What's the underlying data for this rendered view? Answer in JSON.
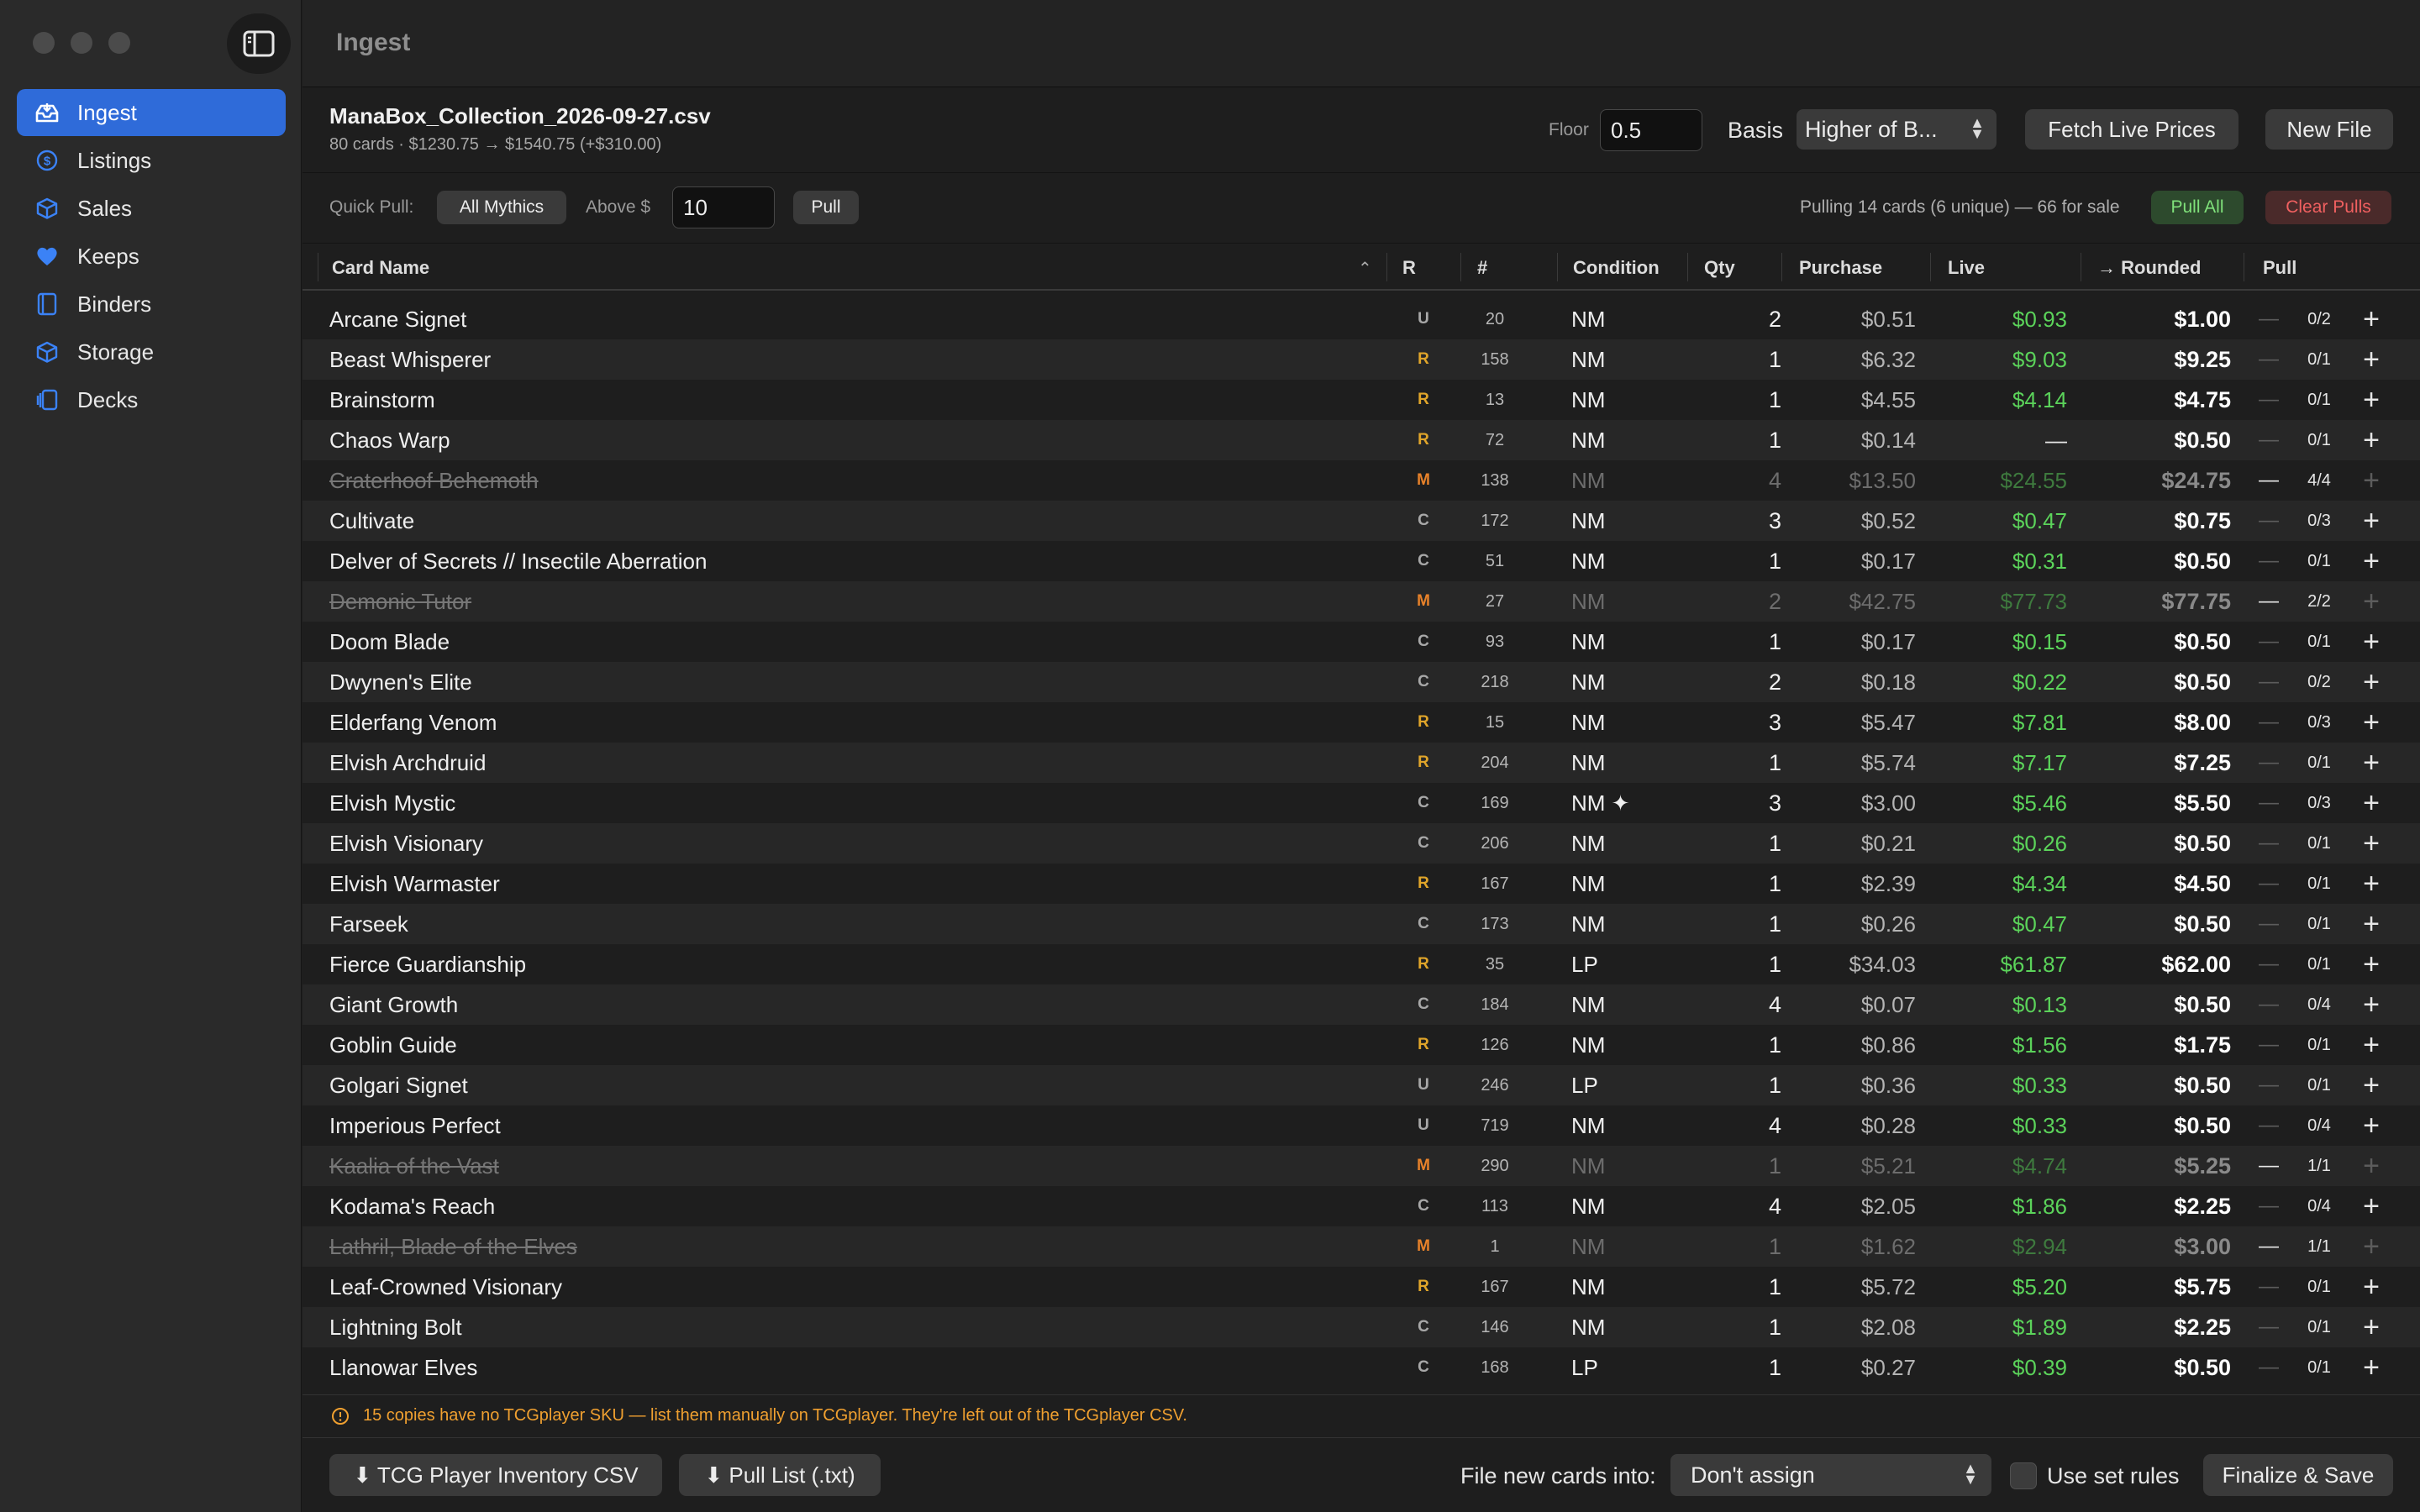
{
  "app": {
    "title": "Ingest"
  },
  "sidebar": {
    "items": [
      {
        "label": "Ingest",
        "icon": "ingest-tray-icon",
        "active": true
      },
      {
        "label": "Listings",
        "icon": "dollar-circle-icon"
      },
      {
        "label": "Sales",
        "icon": "box-icon"
      },
      {
        "label": "Keeps",
        "icon": "heart-icon"
      },
      {
        "label": "Binders",
        "icon": "book-icon"
      },
      {
        "label": "Storage",
        "icon": "cube-icon"
      },
      {
        "label": "Decks",
        "icon": "cards-stack-icon"
      }
    ]
  },
  "file": {
    "name": "ManaBox_Collection_2026-09-27.csv",
    "summary": "80 cards · $1230.75 → $1540.75 (+$310.00)",
    "floor_label": "Floor",
    "floor_value": "0.5",
    "basis_label": "Basis",
    "basis_value": "Higher of B...",
    "fetch_label": "Fetch Live Prices",
    "newfile_label": "New File"
  },
  "quickpull": {
    "label": "Quick Pull:",
    "all_mythics": "All Mythics",
    "above_label": "Above $",
    "above_value": "10",
    "pull_label": "Pull",
    "status": "Pulling 14 cards (6 unique) — 66 for sale",
    "pull_all": "Pull All",
    "clear_pulls": "Clear Pulls"
  },
  "table": {
    "headers": {
      "name": "Card Name",
      "r": "R",
      "num": "#",
      "condition": "Condition",
      "qty": "Qty",
      "purchase": "Purchase",
      "live": "Live",
      "rounded": "→ Rounded",
      "pull": "Pull"
    },
    "rows": [
      {
        "name": "Arcane Signet",
        "r": "U",
        "num": "20",
        "cond": "NM",
        "qty": "2",
        "purchase": "$0.51",
        "live": "$0.93",
        "rounded": "$1.00",
        "pull": "0/2",
        "pulled": false
      },
      {
        "name": "Beast Whisperer",
        "r": "R",
        "num": "158",
        "cond": "NM",
        "qty": "1",
        "purchase": "$6.32",
        "live": "$9.03",
        "rounded": "$9.25",
        "pull": "0/1",
        "pulled": false
      },
      {
        "name": "Brainstorm",
        "r": "R",
        "num": "13",
        "cond": "NM",
        "qty": "1",
        "purchase": "$4.55",
        "live": "$4.14",
        "rounded": "$4.75",
        "pull": "0/1",
        "pulled": false
      },
      {
        "name": "Chaos Warp",
        "r": "R",
        "num": "72",
        "cond": "NM",
        "qty": "1",
        "purchase": "$0.14",
        "live": "—",
        "rounded": "$0.50",
        "pull": "0/1",
        "pulled": false
      },
      {
        "name": "Craterhoof Behemoth",
        "r": "M",
        "num": "138",
        "cond": "NM",
        "qty": "4",
        "purchase": "$13.50",
        "live": "$24.55",
        "rounded": "$24.75",
        "pull": "4/4",
        "pulled": true
      },
      {
        "name": "Cultivate",
        "r": "C",
        "num": "172",
        "cond": "NM",
        "qty": "3",
        "purchase": "$0.52",
        "live": "$0.47",
        "rounded": "$0.75",
        "pull": "0/3",
        "pulled": false
      },
      {
        "name": "Delver of Secrets // Insectile Aberration",
        "r": "C",
        "num": "51",
        "cond": "NM",
        "qty": "1",
        "purchase": "$0.17",
        "live": "$0.31",
        "rounded": "$0.50",
        "pull": "0/1",
        "pulled": false
      },
      {
        "name": "Demonic Tutor",
        "r": "M",
        "num": "27",
        "cond": "NM",
        "qty": "2",
        "purchase": "$42.75",
        "live": "$77.73",
        "rounded": "$77.75",
        "pull": "2/2",
        "pulled": true
      },
      {
        "name": "Doom Blade",
        "r": "C",
        "num": "93",
        "cond": "NM",
        "qty": "1",
        "purchase": "$0.17",
        "live": "$0.15",
        "rounded": "$0.50",
        "pull": "0/1",
        "pulled": false
      },
      {
        "name": "Dwynen's Elite",
        "r": "C",
        "num": "218",
        "cond": "NM",
        "qty": "2",
        "purchase": "$0.18",
        "live": "$0.22",
        "rounded": "$0.50",
        "pull": "0/2",
        "pulled": false
      },
      {
        "name": "Elderfang Venom",
        "r": "R",
        "num": "15",
        "cond": "NM",
        "qty": "3",
        "purchase": "$5.47",
        "live": "$7.81",
        "rounded": "$8.00",
        "pull": "0/3",
        "pulled": false
      },
      {
        "name": "Elvish Archdruid",
        "r": "R",
        "num": "204",
        "cond": "NM",
        "qty": "1",
        "purchase": "$5.74",
        "live": "$7.17",
        "rounded": "$7.25",
        "pull": "0/1",
        "pulled": false
      },
      {
        "name": "Elvish Mystic",
        "r": "C",
        "num": "169",
        "cond": "NM ✦",
        "qty": "3",
        "purchase": "$3.00",
        "live": "$5.46",
        "rounded": "$5.50",
        "pull": "0/3",
        "pulled": false
      },
      {
        "name": "Elvish Visionary",
        "r": "C",
        "num": "206",
        "cond": "NM",
        "qty": "1",
        "purchase": "$0.21",
        "live": "$0.26",
        "rounded": "$0.50",
        "pull": "0/1",
        "pulled": false
      },
      {
        "name": "Elvish Warmaster",
        "r": "R",
        "num": "167",
        "cond": "NM",
        "qty": "1",
        "purchase": "$2.39",
        "live": "$4.34",
        "rounded": "$4.50",
        "pull": "0/1",
        "pulled": false
      },
      {
        "name": "Farseek",
        "r": "C",
        "num": "173",
        "cond": "NM",
        "qty": "1",
        "purchase": "$0.26",
        "live": "$0.47",
        "rounded": "$0.50",
        "pull": "0/1",
        "pulled": false
      },
      {
        "name": "Fierce Guardianship",
        "r": "R",
        "num": "35",
        "cond": "LP",
        "qty": "1",
        "purchase": "$34.03",
        "live": "$61.87",
        "rounded": "$62.00",
        "pull": "0/1",
        "pulled": false
      },
      {
        "name": "Giant Growth",
        "r": "C",
        "num": "184",
        "cond": "NM",
        "qty": "4",
        "purchase": "$0.07",
        "live": "$0.13",
        "rounded": "$0.50",
        "pull": "0/4",
        "pulled": false
      },
      {
        "name": "Goblin Guide",
        "r": "R",
        "num": "126",
        "cond": "NM",
        "qty": "1",
        "purchase": "$0.86",
        "live": "$1.56",
        "rounded": "$1.75",
        "pull": "0/1",
        "pulled": false
      },
      {
        "name": "Golgari Signet",
        "r": "U",
        "num": "246",
        "cond": "LP",
        "qty": "1",
        "purchase": "$0.36",
        "live": "$0.33",
        "rounded": "$0.50",
        "pull": "0/1",
        "pulled": false
      },
      {
        "name": "Imperious Perfect",
        "r": "U",
        "num": "719",
        "cond": "NM",
        "qty": "4",
        "purchase": "$0.28",
        "live": "$0.33",
        "rounded": "$0.50",
        "pull": "0/4",
        "pulled": false
      },
      {
        "name": "Kaalia of the Vast",
        "r": "M",
        "num": "290",
        "cond": "NM",
        "qty": "1",
        "purchase": "$5.21",
        "live": "$4.74",
        "rounded": "$5.25",
        "pull": "1/1",
        "pulled": true
      },
      {
        "name": "Kodama's Reach",
        "r": "C",
        "num": "113",
        "cond": "NM",
        "qty": "4",
        "purchase": "$2.05",
        "live": "$1.86",
        "rounded": "$2.25",
        "pull": "0/4",
        "pulled": false
      },
      {
        "name": "Lathril, Blade of the Elves",
        "r": "M",
        "num": "1",
        "cond": "NM",
        "qty": "1",
        "purchase": "$1.62",
        "live": "$2.94",
        "rounded": "$3.00",
        "pull": "1/1",
        "pulled": true
      },
      {
        "name": "Leaf-Crowned Visionary",
        "r": "R",
        "num": "167",
        "cond": "NM",
        "qty": "1",
        "purchase": "$5.72",
        "live": "$5.20",
        "rounded": "$5.75",
        "pull": "0/1",
        "pulled": false
      },
      {
        "name": "Lightning Bolt",
        "r": "C",
        "num": "146",
        "cond": "NM",
        "qty": "1",
        "purchase": "$2.08",
        "live": "$1.89",
        "rounded": "$2.25",
        "pull": "0/1",
        "pulled": false
      },
      {
        "name": "Llanowar Elves",
        "r": "C",
        "num": "168",
        "cond": "LP",
        "qty": "1",
        "purchase": "$0.27",
        "live": "$0.39",
        "rounded": "$0.50",
        "pull": "0/1",
        "pulled": false
      }
    ]
  },
  "rarity_colors": {
    "U": "#a8a8a8",
    "C": "#a8a8a8",
    "R": "#e0a52a",
    "M": "#e8822a"
  },
  "warning": "15 copies have no TCGplayer SKU — list them manually on TCGplayer. They're left out of the TCGplayer CSV.",
  "footer": {
    "tcg_csv": "⬇ TCG Player Inventory CSV",
    "pull_list": "⬇ Pull List (.txt)",
    "file_into_label": "File new cards into:",
    "file_into_value": "Don't assign",
    "use_set_rules": "Use set rules",
    "use_set_rules_checked": false,
    "finalize": "Finalize & Save"
  }
}
